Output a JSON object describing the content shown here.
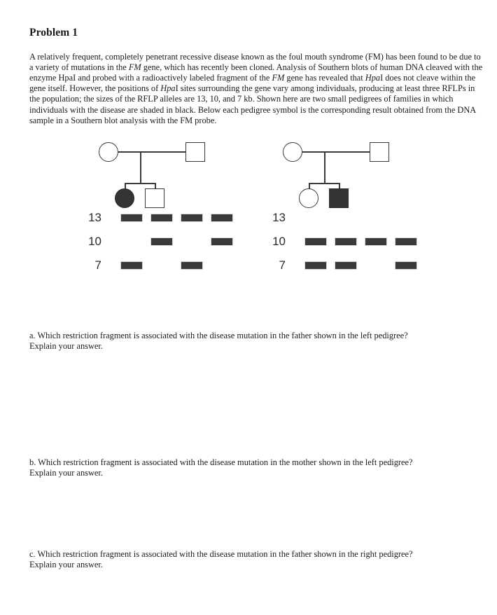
{
  "document": {
    "title": "Problem 1",
    "intro_paragraph": {
      "segments": [
        {
          "text": "A relatively frequent, completely penetrant recessive disease known as the foul mouth syndrome (FM) has been found to be due to a variety of mutations in the ",
          "style": "normal"
        },
        {
          "text": "FM",
          "style": "italic"
        },
        {
          "text": " gene, which has recently been cloned.  Analysis of Southern blots of human DNA cleaved with the enzyme HpaI and probed with a radioactively labeled fragment of the ",
          "style": "normal"
        },
        {
          "text": "FM",
          "style": "italic"
        },
        {
          "text": " gene has revealed that ",
          "style": "normal"
        },
        {
          "text": "Hpa",
          "style": "italic"
        },
        {
          "text": "I does not cleave within the gene itself.  However, the positions of ",
          "style": "normal"
        },
        {
          "text": "Hpa",
          "style": "italic"
        },
        {
          "text": "I sites surrounding the gene vary among individuals, producing at least three RFLPs in the population; the sizes of the RFLP alleles are 13, 10, and 7 kb.  Shown here are two small pedigrees of families in which individuals with the disease are shaded in black.  Below each pedigree symbol is the corresponding result obtained from the DNA sample in a Southern blot analysis with the FM probe.",
          "style": "normal"
        }
      ]
    }
  },
  "figure": {
    "pedigrees": [
      {
        "id": "left-pedigree",
        "parents": [
          {
            "role": "mother",
            "shape": "circle",
            "affected": false
          },
          {
            "role": "father",
            "shape": "square",
            "affected": false
          }
        ],
        "children": [
          {
            "role": "daughter",
            "shape": "circle",
            "affected": true
          },
          {
            "role": "son",
            "shape": "square",
            "affected": false
          }
        ]
      },
      {
        "id": "right-pedigree",
        "parents": [
          {
            "role": "mother",
            "shape": "circle",
            "affected": false
          },
          {
            "role": "father",
            "shape": "square",
            "affected": false
          }
        ],
        "children": [
          {
            "role": "daughter",
            "shape": "circle",
            "affected": false
          },
          {
            "role": "son",
            "shape": "square",
            "affected": true
          }
        ]
      }
    ],
    "gels": [
      {
        "id": "left-gel",
        "lane_labels": [
          "mother",
          "affected-daughter",
          "unaffected-son",
          "father"
        ],
        "rows": [
          {
            "size_label": "13",
            "bands": [
              true,
              true,
              true,
              true
            ]
          },
          {
            "size_label": "10",
            "bands": [
              false,
              true,
              false,
              true
            ]
          },
          {
            "size_label": "7",
            "bands": [
              true,
              false,
              true,
              false
            ]
          }
        ]
      },
      {
        "id": "right-gel",
        "lane_labels": [
          "mother",
          "unaffected-daughter",
          "affected-son",
          "father"
        ],
        "rows": [
          {
            "size_label": "13",
            "bands": [
              false,
              false,
              false,
              false
            ]
          },
          {
            "size_label": "10",
            "bands": [
              true,
              true,
              true,
              true
            ]
          },
          {
            "size_label": "7",
            "bands": [
              true,
              true,
              false,
              true
            ]
          }
        ]
      }
    ],
    "band_color": "#3a3a3a",
    "symbol_stroke_color": "#3a3a3a",
    "affected_fill_color": "#343434"
  },
  "questions": [
    {
      "id": "question-a",
      "line1": "a.  Which restriction fragment is associated with the disease mutation in the father shown in the left pedigree?",
      "line2": "Explain your answer."
    },
    {
      "id": "question-b",
      "line1": "b.  Which restriction fragment is associated with the disease mutation in the mother shown in the left pedigree?",
      "line2": "Explain your answer."
    },
    {
      "id": "question-c",
      "line1": "c.  Which restriction fragment is associated with the disease mutation in the father shown in the right pedigree?",
      "line2": "Explain your answer."
    }
  ]
}
